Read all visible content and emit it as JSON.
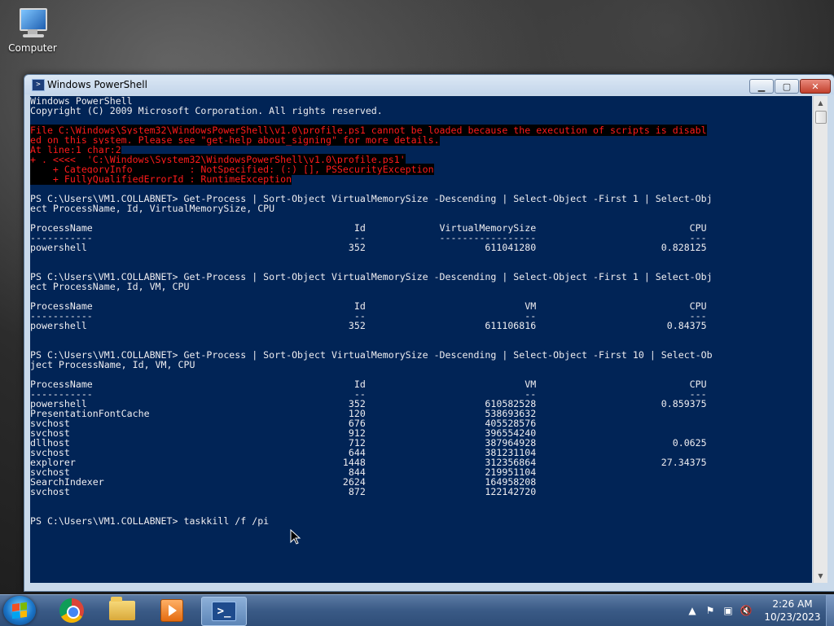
{
  "desktop": {
    "icons": [
      {
        "label": "Computer",
        "icon": "computer-icon"
      }
    ]
  },
  "window": {
    "title": "Windows PowerShell",
    "buttons": {
      "minimize": "▁",
      "maximize": "▢",
      "close": "✕"
    }
  },
  "console": {
    "header": [
      "Windows PowerShell",
      "Copyright (C) 2009 Microsoft Corporation. All rights reserved."
    ],
    "error": [
      "File C:\\Windows\\System32\\WindowsPowerShell\\v1.0\\profile.ps1 cannot be loaded because the execution of scripts is disabl",
      "ed on this system. Please see \"get-help about_signing\" for more details.",
      "At line:1 char:2",
      "+ . <<<<  'C:\\Windows\\System32\\WindowsPowerShell\\v1.0\\profile.ps1'",
      "    + CategoryInfo          : NotSpecified: (:) [], PSSecurityException",
      "    + FullyQualifiedErrorId : RuntimeException"
    ],
    "block1": {
      "prompt": [
        "PS C:\\Users\\VM1.COLLABNET> Get-Process | Sort-Object VirtualMemorySize -Descending | Select-Object -First 1 | Select-Obj",
        "ect ProcessName, Id, VirtualMemorySize, CPU"
      ],
      "headers": [
        "ProcessName",
        "Id",
        "VirtualMemorySize",
        "CPU"
      ],
      "rows": [
        [
          "powershell",
          "352",
          "611041280",
          "0.828125"
        ]
      ]
    },
    "block2": {
      "prompt": [
        "PS C:\\Users\\VM1.COLLABNET> Get-Process | Sort-Object VirtualMemorySize -Descending | Select-Object -First 1 | Select-Obj",
        "ect ProcessName, Id, VM, CPU"
      ],
      "headers": [
        "ProcessName",
        "Id",
        "VM",
        "CPU"
      ],
      "rows": [
        [
          "powershell",
          "352",
          "611106816",
          "0.84375"
        ]
      ]
    },
    "block3": {
      "prompt": [
        "PS C:\\Users\\VM1.COLLABNET> Get-Process | Sort-Object VirtualMemorySize -Descending | Select-Object -First 10 | Select-Ob",
        "ject ProcessName, Id, VM, CPU"
      ],
      "headers": [
        "ProcessName",
        "Id",
        "VM",
        "CPU"
      ],
      "rows": [
        [
          "powershell",
          "352",
          "610582528",
          "0.859375"
        ],
        [
          "PresentationFontCache",
          "120",
          "538693632",
          ""
        ],
        [
          "svchost",
          "676",
          "405528576",
          ""
        ],
        [
          "svchost",
          "912",
          "396554240",
          ""
        ],
        [
          "dllhost",
          "712",
          "387964928",
          "0.0625"
        ],
        [
          "svchost",
          "644",
          "381231104",
          ""
        ],
        [
          "explorer",
          "1448",
          "312356864",
          "27.34375"
        ],
        [
          "svchost",
          "844",
          "219951104",
          ""
        ],
        [
          "SearchIndexer",
          "2624",
          "164958208",
          ""
        ],
        [
          "svchost",
          "872",
          "122142720",
          ""
        ]
      ]
    },
    "current_input": "PS C:\\Users\\VM1.COLLABNET> taskkill /f /pi"
  },
  "taskbar": {
    "apps": [
      "start-orb",
      "chrome-icon",
      "explorer-folder-icon",
      "media-player-icon",
      "powershell-icon"
    ],
    "clock_time": "2:26 AM",
    "clock_date": "10/23/2023"
  }
}
